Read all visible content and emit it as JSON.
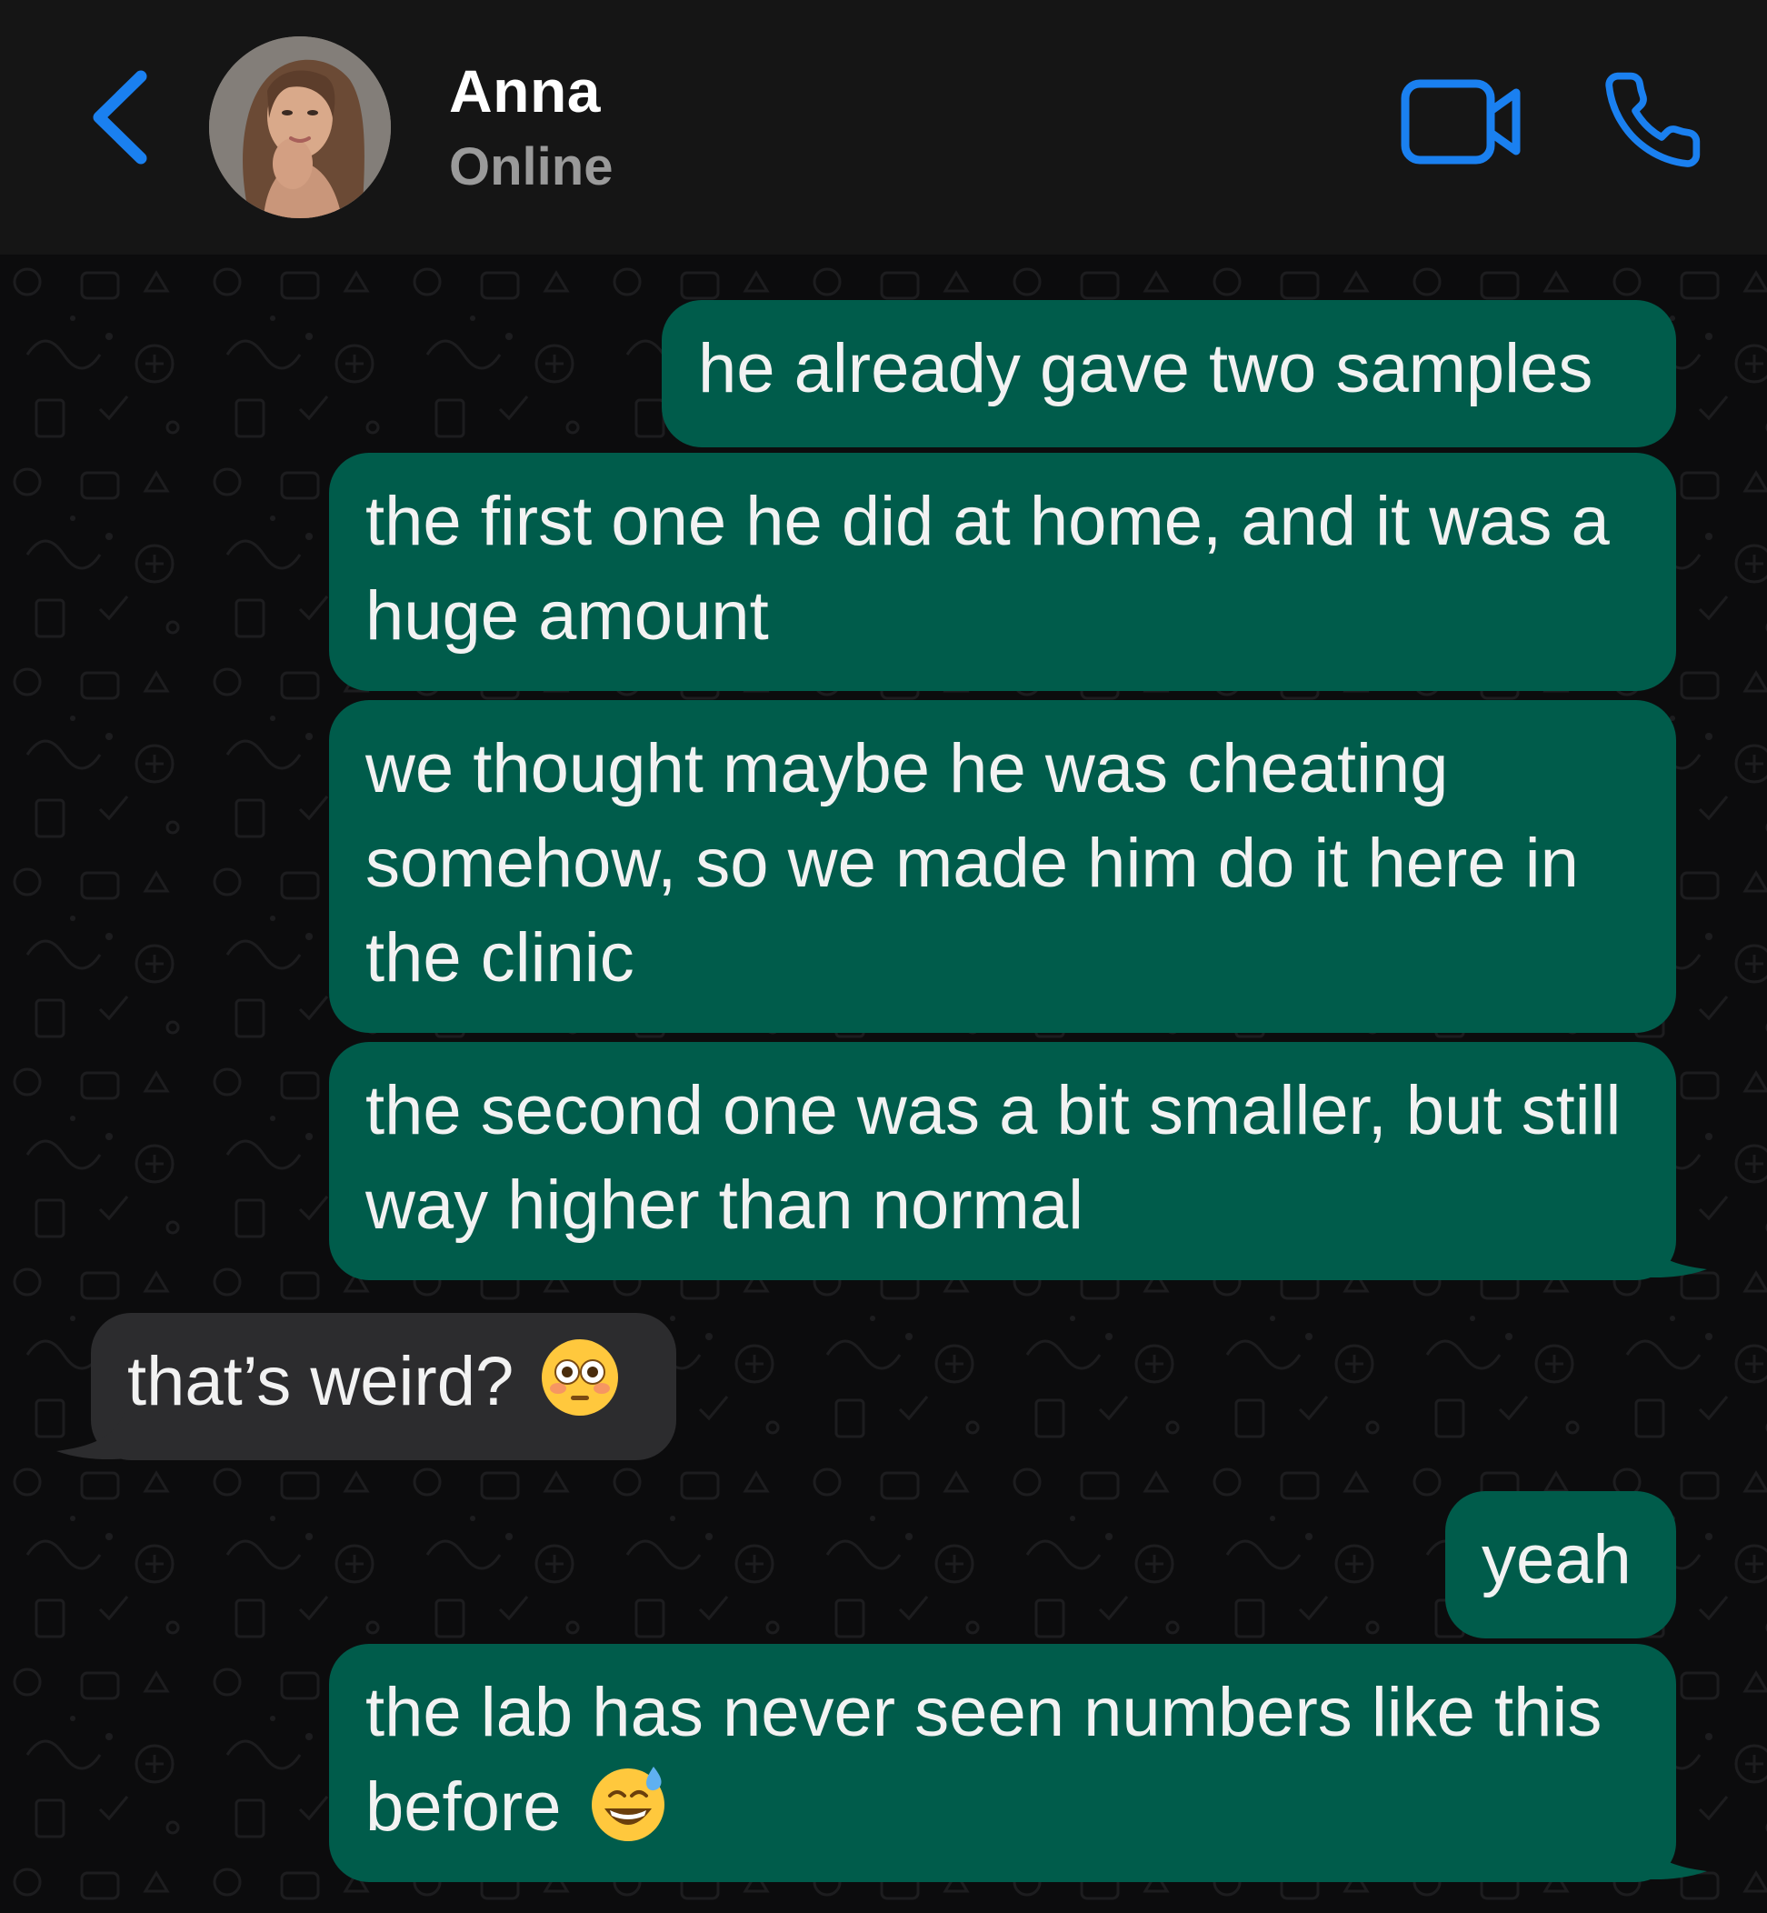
{
  "header": {
    "contact_name": "Anna",
    "status": "Online",
    "back_icon": "chevron-left-icon",
    "video_icon": "video-camera-icon",
    "call_icon": "phone-icon"
  },
  "colors": {
    "header_bg": "#151515",
    "chat_bg": "#0c0c0d",
    "accent_blue": "#1a80f0",
    "outgoing_bubble": "#005c4b",
    "incoming_bubble": "#2c2c2e",
    "text": "#f2f2f2",
    "status_text": "#9a9a9a"
  },
  "messages": [
    {
      "direction": "outgoing",
      "text": "he already gave two samples"
    },
    {
      "direction": "outgoing",
      "text": "the first one he did at home, and it was a huge amount"
    },
    {
      "direction": "outgoing",
      "text": "we thought maybe he was cheating somehow, so we made him do it here in the clinic"
    },
    {
      "direction": "outgoing",
      "text": "the second one was a bit smaller, but still way higher than normal"
    },
    {
      "direction": "incoming",
      "text": "that’s weird?",
      "emoji": "flushed-face-emoji"
    },
    {
      "direction": "outgoing",
      "text": "yeah"
    },
    {
      "direction": "outgoing",
      "text": "the lab has never seen numbers like this before",
      "emoji": "grinning-face-with-sweat-emoji"
    }
  ]
}
